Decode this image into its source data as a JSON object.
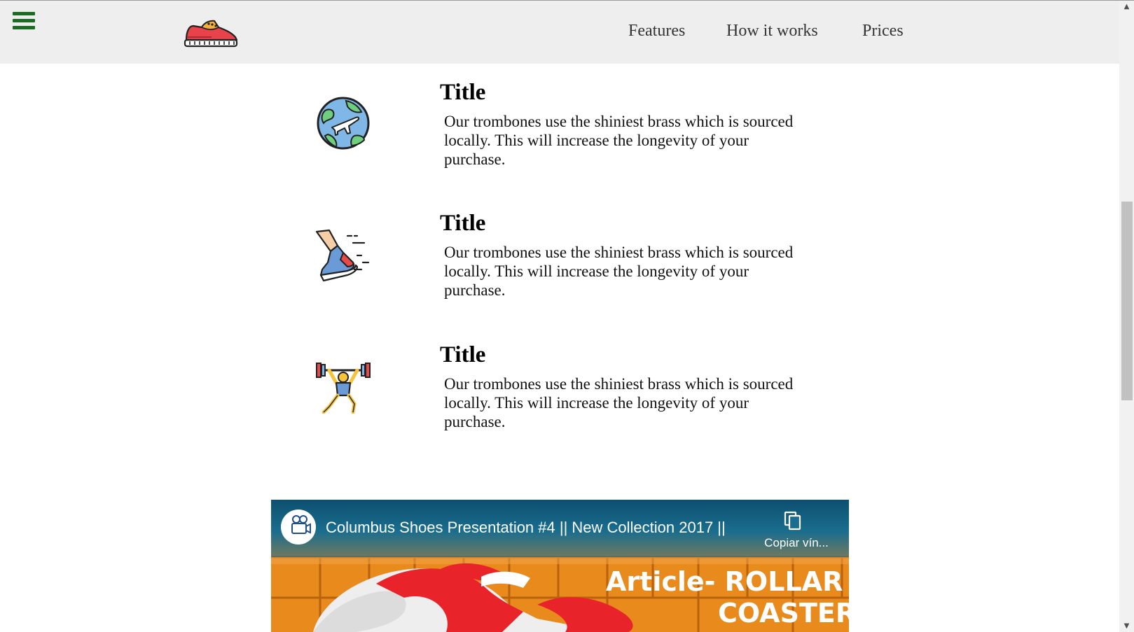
{
  "header": {
    "background": "#eeeeee",
    "menu_icon": "hamburger-menu-icon",
    "menu_color": "#1b6b22",
    "logo_icon": "red-sneaker-logo-icon",
    "nav": [
      {
        "label": "Features"
      },
      {
        "label": "How it works"
      },
      {
        "label": "Prices"
      }
    ]
  },
  "features": [
    {
      "icon": "globe-airplane-icon",
      "title": "Title",
      "text": "Our trombones use the shiniest brass which is sourced locally. This will increase the longevity of your purchase."
    },
    {
      "icon": "running-shoe-foot-icon",
      "title": "Title",
      "text": "Our trombones use the shiniest brass which is sourced locally. This will increase the longevity of your purchase."
    },
    {
      "icon": "weightlifter-icon",
      "title": "Title",
      "text": "Our trombones use the shiniest brass which is sourced locally. This will increase the longevity of your purchase."
    }
  ],
  "video": {
    "title": "Columbus Shoes Presentation #4 || New Collection 2017 ||",
    "copy_label": "Copiar vín...",
    "copy_icon": "copy-link-icon",
    "channel_avatar_icon": "channel-camera-logo-icon",
    "overlay_line1": "Article- ROLLAR",
    "overlay_line2": "COASTER",
    "accent_orange": "#e8891e",
    "accent_red": "#e8242a"
  },
  "scrollbar": {
    "up_arrow": "▲",
    "down_arrow": "▼"
  }
}
